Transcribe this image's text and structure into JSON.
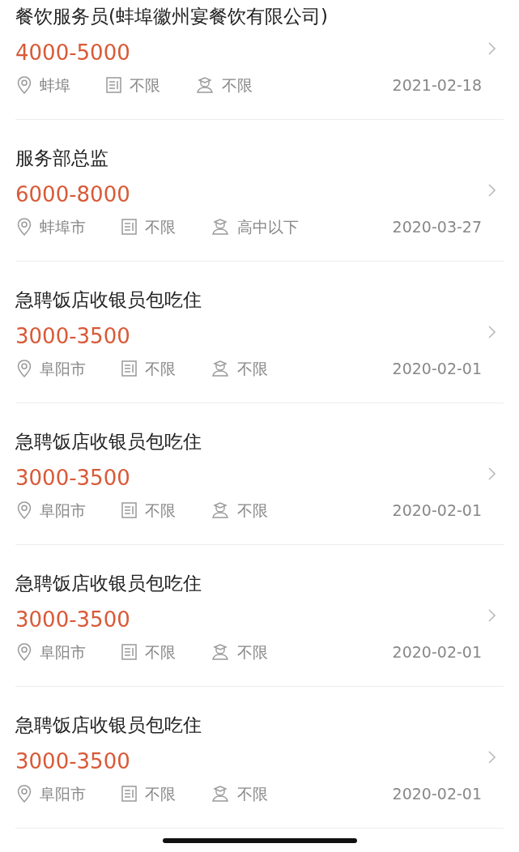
{
  "jobs": [
    {
      "title": "餐饮服务员(蚌埠徽州宴餐饮有限公司)",
      "salary": "4000-5000",
      "location": "蚌埠",
      "experience": "不限",
      "education": "不限",
      "date": "2021-02-18"
    },
    {
      "title": "服务部总监",
      "salary": "6000-8000",
      "location": "蚌埠市",
      "experience": "不限",
      "education": "高中以下",
      "date": "2020-03-27"
    },
    {
      "title": "急聘饭店收银员包吃住",
      "salary": "3000-3500",
      "location": "阜阳市",
      "experience": "不限",
      "education": "不限",
      "date": "2020-02-01"
    },
    {
      "title": "急聘饭店收银员包吃住",
      "salary": "3000-3500",
      "location": "阜阳市",
      "experience": "不限",
      "education": "不限",
      "date": "2020-02-01"
    },
    {
      "title": "急聘饭店收银员包吃住",
      "salary": "3000-3500",
      "location": "阜阳市",
      "experience": "不限",
      "education": "不限",
      "date": "2020-02-01"
    },
    {
      "title": "急聘饭店收银员包吃住",
      "salary": "3000-3500",
      "location": "阜阳市",
      "experience": "不限",
      "education": "不限",
      "date": "2020-02-01"
    }
  ]
}
